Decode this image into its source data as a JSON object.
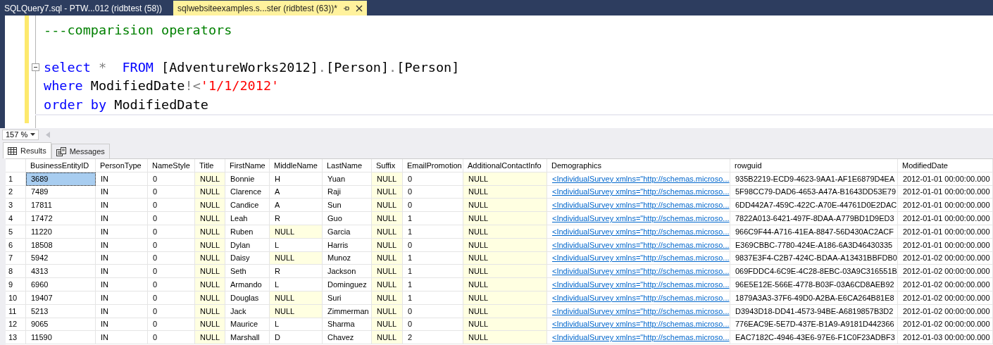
{
  "document_tabs": [
    {
      "label": "SQLQuery7.sql - PTW...012 (ridbtest (58))",
      "selected": false
    },
    {
      "label": "sqlwebsiteexamples.s...ster (ridbtest (63))*",
      "selected": true
    }
  ],
  "editor": {
    "lines": [
      {
        "kind": "code",
        "current": false,
        "collapsible": false,
        "tokens": [
          {
            "kind": "comment",
            "text": "---comparision operators"
          }
        ]
      },
      {
        "kind": "blank"
      },
      {
        "kind": "code",
        "current": false,
        "collapsible": true,
        "tokens": [
          {
            "kind": "keyword",
            "text": "select"
          },
          {
            "kind": "gray",
            "text": " *  "
          },
          {
            "kind": "keyword",
            "text": "FROM"
          },
          {
            "kind": "plain",
            "text": " [AdventureWorks2012]"
          },
          {
            "kind": "gray",
            "text": "."
          },
          {
            "kind": "plain",
            "text": "[Person]"
          },
          {
            "kind": "gray",
            "text": "."
          },
          {
            "kind": "plain",
            "text": "[Person]"
          }
        ]
      },
      {
        "kind": "code",
        "current": false,
        "collapsible": false,
        "tokens": [
          {
            "kind": "keyword",
            "text": "where"
          },
          {
            "kind": "plain",
            "text": " ModifiedDate"
          },
          {
            "kind": "gray",
            "text": "!<"
          },
          {
            "kind": "string",
            "text": "'1/1/2012'"
          }
        ]
      },
      {
        "kind": "code",
        "current": false,
        "collapsible": false,
        "tokens": [
          {
            "kind": "keyword",
            "text": "order by"
          },
          {
            "kind": "plain",
            "text": " ModifiedDate"
          }
        ]
      },
      {
        "kind": "code",
        "current": true,
        "collapsible": false
      }
    ],
    "zoom": "157 %"
  },
  "result_tabs": [
    {
      "label": "Results",
      "kind": "grid",
      "selected": true
    },
    {
      "label": "Messages",
      "kind": "messages",
      "selected": false
    }
  ],
  "grid": {
    "columns": [
      {
        "label": "BusinessEntityID",
        "kind": "text"
      },
      {
        "label": "PersonType",
        "kind": "text"
      },
      {
        "label": "NameStyle",
        "kind": "text"
      },
      {
        "label": "Title",
        "kind": "text"
      },
      {
        "label": "FirstName",
        "kind": "text"
      },
      {
        "label": "MiddleName",
        "kind": "text"
      },
      {
        "label": "LastName",
        "kind": "text"
      },
      {
        "label": "Suffix",
        "kind": "text"
      },
      {
        "label": "EmailPromotion",
        "kind": "text"
      },
      {
        "label": "AdditionalContactInfo",
        "kind": "text"
      },
      {
        "label": "Demographics",
        "kind": "link"
      },
      {
        "label": "rowguid",
        "kind": "text"
      },
      {
        "label": "ModifiedDate",
        "kind": "text"
      }
    ],
    "rows": [
      {
        "number": "1",
        "selected": true,
        "cells": [
          "3689",
          "IN",
          "0",
          {
            "kind": "null",
            "text": "NULL"
          },
          "Bonnie",
          "H",
          "Yuan",
          {
            "kind": "null",
            "text": "NULL"
          },
          "0",
          {
            "kind": "null",
            "text": "NULL"
          },
          "<IndividualSurvey xmlns=\"http://schemas.microso...",
          "935B2219-ECD9-4623-9AA1-AF1E6879D4EA",
          "2012-01-01 00:00:00.000"
        ]
      },
      {
        "number": "2",
        "selected": false,
        "cells": [
          "7489",
          "IN",
          "0",
          {
            "kind": "null",
            "text": "NULL"
          },
          "Clarence",
          "A",
          "Raji",
          {
            "kind": "null",
            "text": "NULL"
          },
          "0",
          {
            "kind": "null",
            "text": "NULL"
          },
          "<IndividualSurvey xmlns=\"http://schemas.microso...",
          "5F98CC79-DAD6-4653-A47A-B1643DD53E79",
          "2012-01-01 00:00:00.000"
        ]
      },
      {
        "number": "3",
        "selected": false,
        "cells": [
          "17811",
          "IN",
          "0",
          {
            "kind": "null",
            "text": "NULL"
          },
          "Candice",
          "A",
          "Sun",
          {
            "kind": "null",
            "text": "NULL"
          },
          "0",
          {
            "kind": "null",
            "text": "NULL"
          },
          "<IndividualSurvey xmlns=\"http://schemas.microso...",
          "6DD442A7-459C-422C-A70E-44761D0E2DAC",
          "2012-01-01 00:00:00.000"
        ]
      },
      {
        "number": "4",
        "selected": false,
        "cells": [
          "17472",
          "IN",
          "0",
          {
            "kind": "null",
            "text": "NULL"
          },
          "Leah",
          "R",
          "Guo",
          {
            "kind": "null",
            "text": "NULL"
          },
          "1",
          {
            "kind": "null",
            "text": "NULL"
          },
          "<IndividualSurvey xmlns=\"http://schemas.microso...",
          "7822A013-6421-497F-8DAA-A779BD1D9ED3",
          "2012-01-01 00:00:00.000"
        ]
      },
      {
        "number": "5",
        "selected": false,
        "cells": [
          "11220",
          "IN",
          "0",
          {
            "kind": "null",
            "text": "NULL"
          },
          "Ruben",
          {
            "kind": "null",
            "text": "NULL"
          },
          "Garcia",
          {
            "kind": "null",
            "text": "NULL"
          },
          "1",
          {
            "kind": "null",
            "text": "NULL"
          },
          "<IndividualSurvey xmlns=\"http://schemas.microso...",
          "966C9F44-A716-41EA-8847-56D430AC2ACF",
          "2012-01-01 00:00:00.000"
        ]
      },
      {
        "number": "6",
        "selected": false,
        "cells": [
          "18508",
          "IN",
          "0",
          {
            "kind": "null",
            "text": "NULL"
          },
          "Dylan",
          "L",
          "Harris",
          {
            "kind": "null",
            "text": "NULL"
          },
          "0",
          {
            "kind": "null",
            "text": "NULL"
          },
          "<IndividualSurvey xmlns=\"http://schemas.microso...",
          "E369CBBC-7780-424E-A186-6A3D46430335",
          "2012-01-01 00:00:00.000"
        ]
      },
      {
        "number": "7",
        "selected": false,
        "cells": [
          "5942",
          "IN",
          "0",
          {
            "kind": "null",
            "text": "NULL"
          },
          "Daisy",
          {
            "kind": "null",
            "text": "NULL"
          },
          "Munoz",
          {
            "kind": "null",
            "text": "NULL"
          },
          "1",
          {
            "kind": "null",
            "text": "NULL"
          },
          "<IndividualSurvey xmlns=\"http://schemas.microso...",
          "9837E3F4-C2B7-424C-BDAA-A13431BBFDB0",
          "2012-01-02 00:00:00.000"
        ]
      },
      {
        "number": "8",
        "selected": false,
        "cells": [
          "4313",
          "IN",
          "0",
          {
            "kind": "null",
            "text": "NULL"
          },
          "Seth",
          "R",
          "Jackson",
          {
            "kind": "null",
            "text": "NULL"
          },
          "1",
          {
            "kind": "null",
            "text": "NULL"
          },
          "<IndividualSurvey xmlns=\"http://schemas.microso...",
          "069FDDC4-6C9E-4C28-8EBC-03A9C316551B",
          "2012-01-02 00:00:00.000"
        ]
      },
      {
        "number": "9",
        "selected": false,
        "cells": [
          "6960",
          "IN",
          "0",
          {
            "kind": "null",
            "text": "NULL"
          },
          "Armando",
          "L",
          "Dominguez",
          {
            "kind": "null",
            "text": "NULL"
          },
          "1",
          {
            "kind": "null",
            "text": "NULL"
          },
          "<IndividualSurvey xmlns=\"http://schemas.microso...",
          "96E5E12E-566E-4778-B03F-03A6CD8AEB92",
          "2012-01-02 00:00:00.000"
        ]
      },
      {
        "number": "10",
        "selected": false,
        "cells": [
          "19407",
          "IN",
          "0",
          {
            "kind": "null",
            "text": "NULL"
          },
          "Douglas",
          {
            "kind": "null",
            "text": "NULL"
          },
          "Suri",
          {
            "kind": "null",
            "text": "NULL"
          },
          "1",
          {
            "kind": "null",
            "text": "NULL"
          },
          "<IndividualSurvey xmlns=\"http://schemas.microso...",
          "1879A3A3-37F6-49D0-A2BA-E6CA264B81E8",
          "2012-01-02 00:00:00.000"
        ]
      },
      {
        "number": "11",
        "selected": false,
        "cells": [
          "5213",
          "IN",
          "0",
          {
            "kind": "null",
            "text": "NULL"
          },
          "Jack",
          {
            "kind": "null",
            "text": "NULL"
          },
          "Zimmerman",
          {
            "kind": "null",
            "text": "NULL"
          },
          "0",
          {
            "kind": "null",
            "text": "NULL"
          },
          "<IndividualSurvey xmlns=\"http://schemas.microso...",
          "D3943D18-DD41-4573-94BE-A6819857B3D2",
          "2012-01-02 00:00:00.000"
        ]
      },
      {
        "number": "12",
        "selected": false,
        "cells": [
          "9065",
          "IN",
          "0",
          {
            "kind": "null",
            "text": "NULL"
          },
          "Maurice",
          "L",
          "Sharma",
          {
            "kind": "null",
            "text": "NULL"
          },
          "0",
          {
            "kind": "null",
            "text": "NULL"
          },
          "<IndividualSurvey xmlns=\"http://schemas.microso...",
          "776EAC9E-5E7D-437E-B1A9-A9181D442366",
          "2012-01-02 00:00:00.000"
        ]
      },
      {
        "number": "13",
        "selected": false,
        "cells": [
          "11590",
          "IN",
          "0",
          {
            "kind": "null",
            "text": "NULL"
          },
          "Marshall",
          "D",
          "Chavez",
          {
            "kind": "null",
            "text": "NULL"
          },
          "2",
          {
            "kind": "null",
            "text": "NULL"
          },
          "<IndividualSurvey xmlns=\"http://schemas.microso...",
          "EAC7182C-4946-43E6-97E6-F1C0F23ADBF3",
          "2012-01-03 00:00:00.000"
        ]
      }
    ]
  }
}
